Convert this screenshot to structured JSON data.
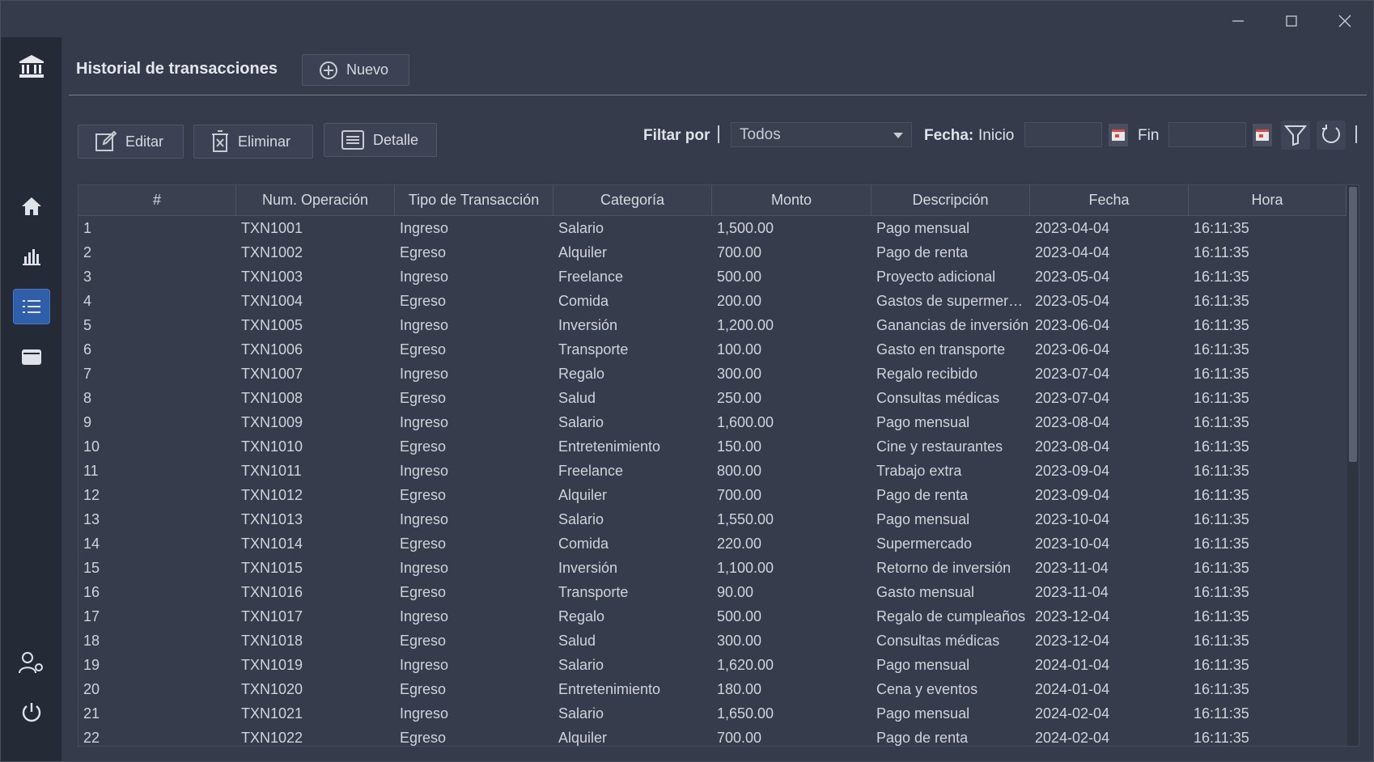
{
  "window": {
    "controls": [
      "minimize-icon",
      "maximize-icon",
      "close-icon"
    ]
  },
  "sidebar": {
    "logo_icon": "bank-icon",
    "items": [
      {
        "icon": "home-icon",
        "active": false
      },
      {
        "icon": "bar-chart-icon",
        "active": false
      },
      {
        "icon": "list-icon",
        "active": true
      },
      {
        "icon": "wallet-icon",
        "active": false
      }
    ],
    "bottom_items": [
      {
        "icon": "user-settings-icon"
      },
      {
        "icon": "power-icon"
      }
    ]
  },
  "header": {
    "title": "Historial de transacciones",
    "new_label": "Nuevo"
  },
  "toolbar": {
    "edit_label": "Editar",
    "delete_label": "Eliminar",
    "detail_label": "Detalle"
  },
  "filters": {
    "filter_label": "Filtar por",
    "select_value": "Todos",
    "date_label": "Fecha:",
    "start_label": "Inicio",
    "start_value": "",
    "end_label": "Fin",
    "end_value": ""
  },
  "colors": {
    "background": "#353b4a",
    "sidebar": "#252a37",
    "accent": "#2f5fa8"
  },
  "table": {
    "columns": [
      "#",
      "Num. Operación",
      "Tipo de Transacción",
      "Categoría",
      "Monto",
      "Descripción",
      "Fecha",
      "Hora"
    ],
    "rows": [
      [
        "1",
        "TXN1001",
        "Ingreso",
        "Salario",
        "1,500.00",
        "Pago mensual",
        "2023-04-04",
        "16:11:35"
      ],
      [
        "2",
        "TXN1002",
        "Egreso",
        "Alquiler",
        "700.00",
        "Pago de renta",
        "2023-04-04",
        "16:11:35"
      ],
      [
        "3",
        "TXN1003",
        "Ingreso",
        "Freelance",
        "500.00",
        "Proyecto adicional",
        "2023-05-04",
        "16:11:35"
      ],
      [
        "4",
        "TXN1004",
        "Egreso",
        "Comida",
        "200.00",
        "Gastos de supermerca...",
        "2023-05-04",
        "16:11:35"
      ],
      [
        "5",
        "TXN1005",
        "Ingreso",
        "Inversión",
        "1,200.00",
        "Ganancias de inversión",
        "2023-06-04",
        "16:11:35"
      ],
      [
        "6",
        "TXN1006",
        "Egreso",
        "Transporte",
        "100.00",
        "Gasto en transporte",
        "2023-06-04",
        "16:11:35"
      ],
      [
        "7",
        "TXN1007",
        "Ingreso",
        "Regalo",
        "300.00",
        "Regalo recibido",
        "2023-07-04",
        "16:11:35"
      ],
      [
        "8",
        "TXN1008",
        "Egreso",
        "Salud",
        "250.00",
        "Consultas médicas",
        "2023-07-04",
        "16:11:35"
      ],
      [
        "9",
        "TXN1009",
        "Ingreso",
        "Salario",
        "1,600.00",
        "Pago mensual",
        "2023-08-04",
        "16:11:35"
      ],
      [
        "10",
        "TXN1010",
        "Egreso",
        "Entretenimiento",
        "150.00",
        "Cine y restaurantes",
        "2023-08-04",
        "16:11:35"
      ],
      [
        "11",
        "TXN1011",
        "Ingreso",
        "Freelance",
        "800.00",
        "Trabajo extra",
        "2023-09-04",
        "16:11:35"
      ],
      [
        "12",
        "TXN1012",
        "Egreso",
        "Alquiler",
        "700.00",
        "Pago de renta",
        "2023-09-04",
        "16:11:35"
      ],
      [
        "13",
        "TXN1013",
        "Ingreso",
        "Salario",
        "1,550.00",
        "Pago mensual",
        "2023-10-04",
        "16:11:35"
      ],
      [
        "14",
        "TXN1014",
        "Egreso",
        "Comida",
        "220.00",
        "Supermercado",
        "2023-10-04",
        "16:11:35"
      ],
      [
        "15",
        "TXN1015",
        "Ingreso",
        "Inversión",
        "1,100.00",
        "Retorno de inversión",
        "2023-11-04",
        "16:11:35"
      ],
      [
        "16",
        "TXN1016",
        "Egreso",
        "Transporte",
        "90.00",
        "Gasto mensual",
        "2023-11-04",
        "16:11:35"
      ],
      [
        "17",
        "TXN1017",
        "Ingreso",
        "Regalo",
        "500.00",
        "Regalo de cumpleaños",
        "2023-12-04",
        "16:11:35"
      ],
      [
        "18",
        "TXN1018",
        "Egreso",
        "Salud",
        "300.00",
        "Consultas médicas",
        "2023-12-04",
        "16:11:35"
      ],
      [
        "19",
        "TXN1019",
        "Ingreso",
        "Salario",
        "1,620.00",
        "Pago mensual",
        "2024-01-04",
        "16:11:35"
      ],
      [
        "20",
        "TXN1020",
        "Egreso",
        "Entretenimiento",
        "180.00",
        "Cena y eventos",
        "2024-01-04",
        "16:11:35"
      ],
      [
        "21",
        "TXN1021",
        "Ingreso",
        "Salario",
        "1,650.00",
        "Pago mensual",
        "2024-02-04",
        "16:11:35"
      ],
      [
        "22",
        "TXN1022",
        "Egreso",
        "Alquiler",
        "700.00",
        "Pago de renta",
        "2024-02-04",
        "16:11:35"
      ]
    ]
  }
}
